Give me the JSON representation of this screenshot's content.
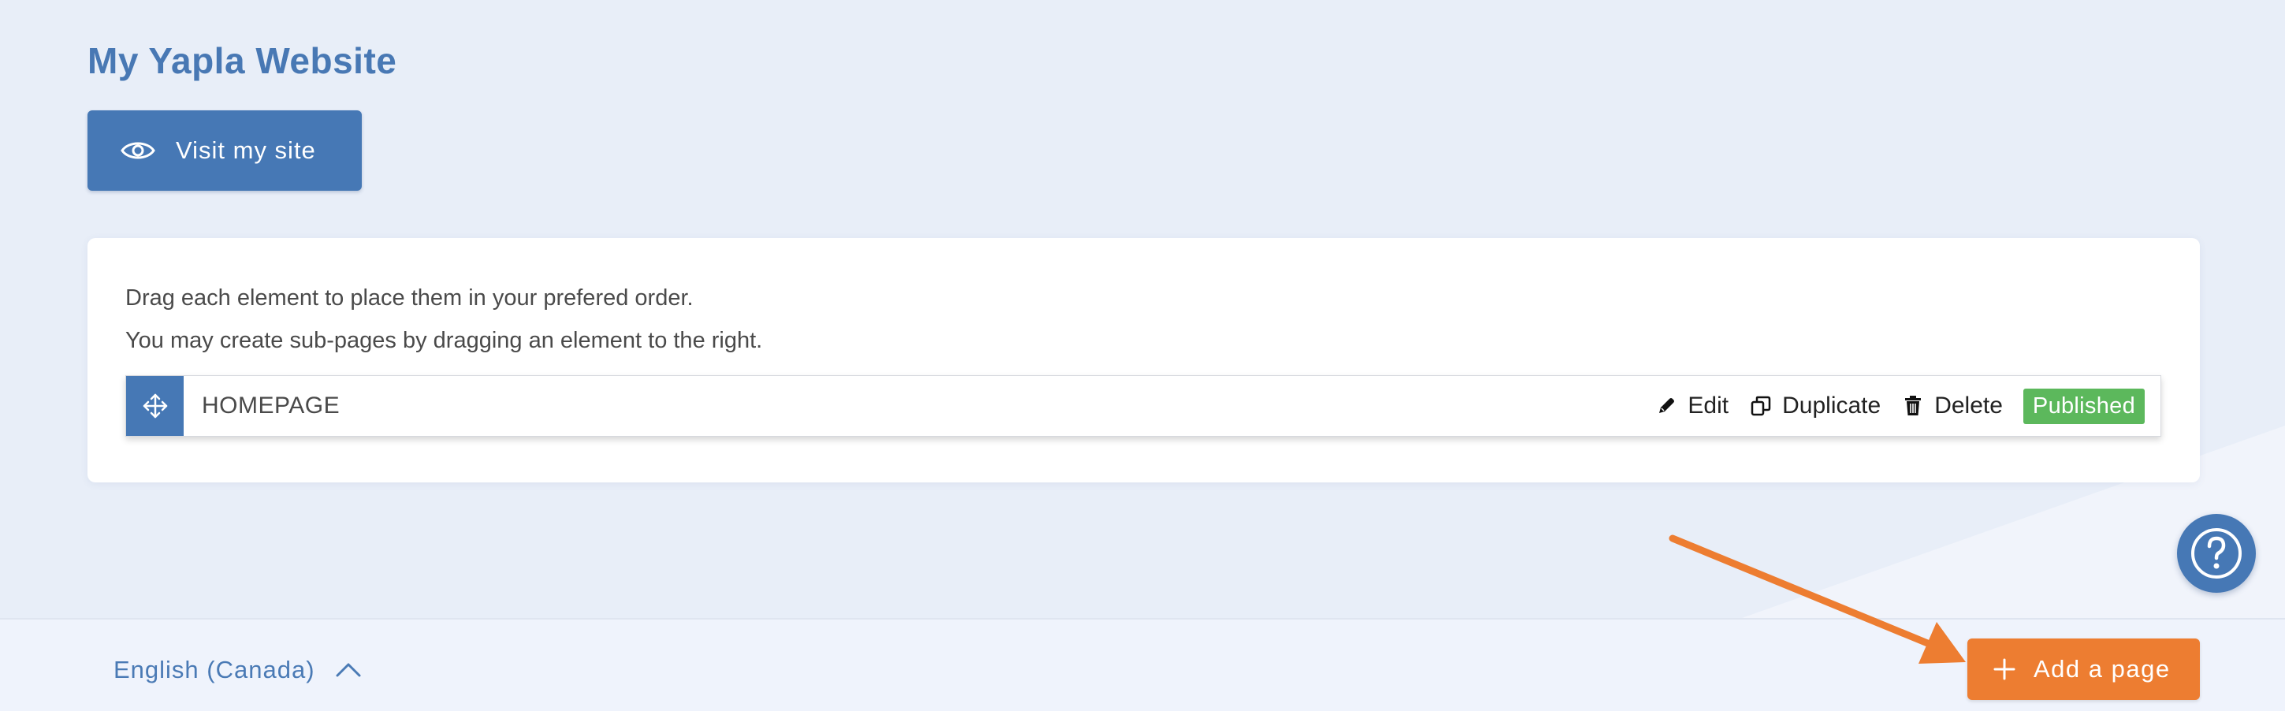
{
  "header": {
    "site_title": "My Yapla Website",
    "visit_button_label": "Visit my site",
    "visit_icon": "eye-icon"
  },
  "card": {
    "instruction_1": "Drag each element to place them in your prefered order.",
    "instruction_2": "You may create sub-pages by dragging an element to the right.",
    "pages": [
      {
        "name": "HOMEPAGE",
        "actions": {
          "edit": "Edit",
          "duplicate": "Duplicate",
          "delete": "Delete"
        },
        "status": "Published"
      }
    ]
  },
  "footer": {
    "language": "English (Canada)",
    "add_page_label": "Add a page"
  },
  "icons": {
    "drag": "move-arrows-icon",
    "edit": "pencil-icon",
    "duplicate": "copy-icon",
    "delete": "trash-icon",
    "help": "question-mark-icon",
    "language_toggle": "chevron-up-icon",
    "add": "plus-icon",
    "annotation": "orange-arrow-icon"
  },
  "colors": {
    "primary": "#4678b5",
    "accent": "#ed7d31",
    "success": "#5cb85c",
    "background": "#e8eef8",
    "footer_bg": "#eff3fc"
  }
}
